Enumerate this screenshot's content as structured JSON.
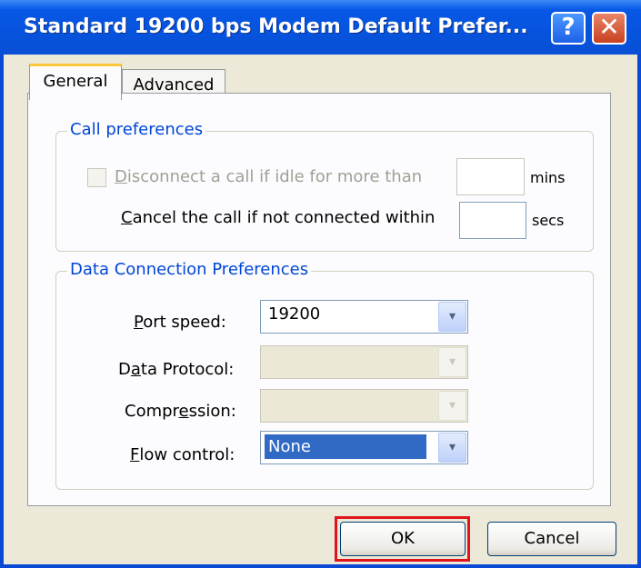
{
  "window": {
    "title": "Standard 19200 bps Modem Default Prefer...",
    "help_glyph": "?",
    "close_glyph": "✕"
  },
  "tabs": [
    {
      "label": "General",
      "active": true
    },
    {
      "label": "Advanced",
      "active": false
    }
  ],
  "call_preferences": {
    "title": "Call preferences",
    "disconnect": {
      "label_prefix": "",
      "label_accel": "D",
      "label_rest": "isconnect a call if idle for more than",
      "checked": false,
      "enabled": false,
      "value": "",
      "unit": "mins"
    },
    "cancel": {
      "label_accel": "C",
      "label_rest": "ancel the call if not connected within",
      "value": "",
      "unit": "secs"
    }
  },
  "data_connection": {
    "title": "Data Connection Preferences",
    "port_speed": {
      "accel": "P",
      "rest": "ort speed:",
      "value": "19200",
      "enabled": true
    },
    "data_protocol": {
      "pre": "D",
      "accel": "a",
      "rest": "ta Protocol:",
      "value": "",
      "enabled": false
    },
    "compression": {
      "pre": "Compr",
      "accel": "e",
      "rest": "ssion:",
      "value": "",
      "enabled": false
    },
    "flow_control": {
      "accel": "F",
      "rest": "low control:",
      "value": "None",
      "enabled": true,
      "focused": true
    }
  },
  "buttons": {
    "ok": "OK",
    "cancel": "Cancel"
  },
  "icons": {
    "dropdown": "▾",
    "dropdown_icon": "chevron-down-icon"
  },
  "colors": {
    "title_bar": "#0858e6",
    "group_title": "#0046d5",
    "selection": "#316ac5",
    "highlight_box": "#e0141c"
  }
}
